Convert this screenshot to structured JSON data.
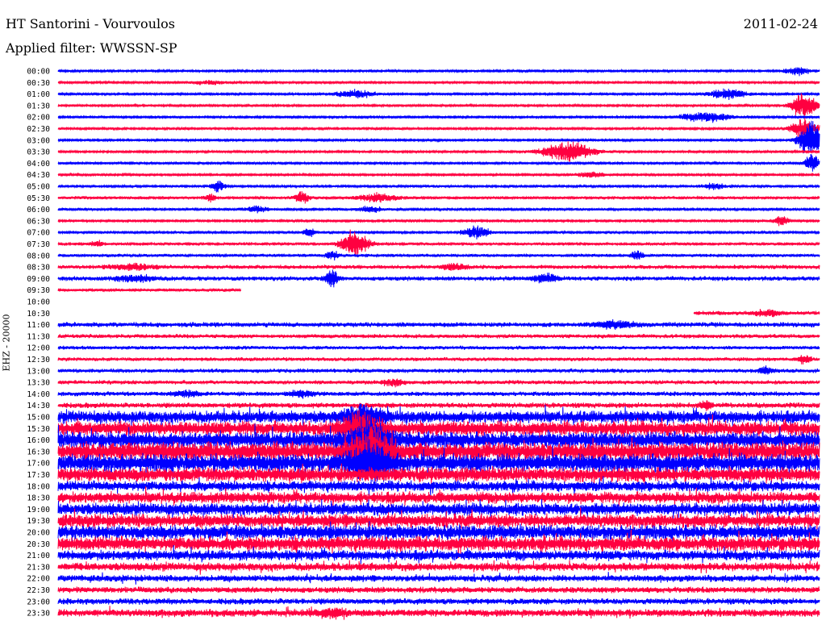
{
  "header": {
    "station": "HT Santorini - Vourvoulos",
    "date": "2011-02-24",
    "filter": "Applied filter: WWSSN-SP"
  },
  "channel_label": "EHZ - 20000",
  "colors": {
    "odd_trace": "#0000ff",
    "even_trace": "#ff0040"
  },
  "chart_data": {
    "type": "line",
    "description_type": "helicorder",
    "row_labels": [
      "00:00",
      "00:30",
      "01:00",
      "01:30",
      "02:00",
      "02:30",
      "03:00",
      "03:30",
      "04:00",
      "04:30",
      "05:00",
      "05:30",
      "06:00",
      "06:30",
      "07:00",
      "07:30",
      "08:00",
      "08:30",
      "09:00",
      "09:30",
      "10:00",
      "10:30",
      "11:00",
      "11:30",
      "12:00",
      "12:30",
      "13:00",
      "13:30",
      "14:00",
      "14:30",
      "15:00",
      "15:30",
      "16:00",
      "16:30",
      "17:00",
      "17:30",
      "18:00",
      "18:30",
      "19:00",
      "19:30",
      "20:00",
      "20:30",
      "21:00",
      "21:30",
      "22:00",
      "22:30",
      "23:00",
      "23:30"
    ],
    "row_minutes": 30,
    "rows": [
      {
        "amp": 1.0,
        "start": 0,
        "end": 1,
        "events": [
          [
            0.97,
            4,
            0.02
          ]
        ]
      },
      {
        "amp": 1.0,
        "start": 0,
        "end": 1,
        "events": [
          [
            0.2,
            2,
            0.03
          ]
        ]
      },
      {
        "amp": 1.0,
        "start": 0,
        "end": 1,
        "events": [
          [
            0.39,
            4,
            0.03
          ],
          [
            0.88,
            5,
            0.03
          ]
        ]
      },
      {
        "amp": 1.0,
        "start": 0,
        "end": 1,
        "events": [
          [
            0.98,
            12,
            0.02
          ]
        ]
      },
      {
        "amp": 1.0,
        "start": 0,
        "end": 1,
        "events": [
          [
            0.85,
            5,
            0.04
          ]
        ]
      },
      {
        "amp": 1.2,
        "start": 0,
        "end": 1,
        "events": [
          [
            0.98,
            10,
            0.02
          ]
        ]
      },
      {
        "amp": 1.0,
        "start": 0,
        "end": 1,
        "events": [
          [
            0.99,
            18,
            0.02
          ]
        ]
      },
      {
        "amp": 1.0,
        "start": 0,
        "end": 1,
        "events": [
          [
            0.67,
            10,
            0.04
          ]
        ]
      },
      {
        "amp": 1.0,
        "start": 0,
        "end": 1,
        "events": [
          [
            0.99,
            10,
            0.01
          ]
        ]
      },
      {
        "amp": 1.0,
        "start": 0,
        "end": 1,
        "events": [
          [
            0.7,
            3,
            0.02
          ]
        ]
      },
      {
        "amp": 1.2,
        "start": 0,
        "end": 1,
        "events": [
          [
            0.21,
            6,
            0.01
          ],
          [
            0.86,
            3,
            0.02
          ]
        ]
      },
      {
        "amp": 1.5,
        "start": 0,
        "end": 1,
        "events": [
          [
            0.32,
            6,
            0.01
          ],
          [
            0.42,
            4,
            0.03
          ],
          [
            0.2,
            3,
            0.01
          ]
        ]
      },
      {
        "amp": 1.2,
        "start": 0,
        "end": 1,
        "events": [
          [
            0.41,
            3,
            0.02
          ],
          [
            0.26,
            3,
            0.02
          ]
        ]
      },
      {
        "amp": 1.2,
        "start": 0,
        "end": 1,
        "events": [
          [
            0.95,
            5,
            0.01
          ]
        ]
      },
      {
        "amp": 1.2,
        "start": 0,
        "end": 1,
        "events": [
          [
            0.33,
            4,
            0.01
          ],
          [
            0.55,
            6,
            0.02
          ]
        ]
      },
      {
        "amp": 1.4,
        "start": 0,
        "end": 1,
        "events": [
          [
            0.39,
            14,
            0.02
          ],
          [
            0.05,
            3,
            0.01
          ]
        ]
      },
      {
        "amp": 1.5,
        "start": 0,
        "end": 1,
        "events": [
          [
            0.36,
            4,
            0.01
          ],
          [
            0.76,
            4,
            0.01
          ]
        ]
      },
      {
        "amp": 2.0,
        "start": 0,
        "end": 1,
        "events": [
          [
            0.1,
            3,
            0.03
          ],
          [
            0.52,
            3,
            0.02
          ]
        ]
      },
      {
        "amp": 2.2,
        "start": 0,
        "end": 1,
        "events": [
          [
            0.36,
            8,
            0.01
          ],
          [
            0.64,
            4,
            0.02
          ],
          [
            0.1,
            3,
            0.03
          ]
        ]
      },
      {
        "amp": 1.5,
        "start": 0,
        "end": 0.24,
        "events": []
      },
      {
        "amp": 0,
        "start": 0,
        "end": 0,
        "events": []
      },
      {
        "amp": 2.0,
        "start": 0.835,
        "end": 1,
        "events": [
          [
            0.93,
            3,
            0.02
          ]
        ]
      },
      {
        "amp": 2.4,
        "start": 0.0,
        "end": 1,
        "events": [
          [
            0.73,
            3,
            0.03
          ]
        ]
      },
      {
        "amp": 2.0,
        "start": 0,
        "end": 1,
        "events": []
      },
      {
        "amp": 1.8,
        "start": 0,
        "end": 1,
        "events": []
      },
      {
        "amp": 1.8,
        "start": 0,
        "end": 1,
        "events": [
          [
            0.98,
            4,
            0.01
          ]
        ]
      },
      {
        "amp": 2.0,
        "start": 0,
        "end": 1,
        "events": [
          [
            0.93,
            4,
            0.01
          ]
        ]
      },
      {
        "amp": 2.0,
        "start": 0,
        "end": 1,
        "events": [
          [
            0.44,
            3,
            0.02
          ]
        ]
      },
      {
        "amp": 2.2,
        "start": 0,
        "end": 1,
        "events": [
          [
            0.17,
            3,
            0.02
          ],
          [
            0.32,
            3,
            0.02
          ]
        ]
      },
      {
        "amp": 2.6,
        "start": 0,
        "end": 1,
        "events": [
          [
            0.85,
            4,
            0.01
          ]
        ]
      },
      {
        "amp": 6.0,
        "start": 0,
        "end": 1,
        "events": [
          [
            0.4,
            10,
            0.03
          ]
        ]
      },
      {
        "amp": 7.0,
        "start": 0,
        "end": 1,
        "events": [
          [
            0.4,
            14,
            0.03
          ]
        ]
      },
      {
        "amp": 8.0,
        "start": 0,
        "end": 1,
        "events": [
          [
            0.41,
            16,
            0.03
          ]
        ]
      },
      {
        "amp": 9.0,
        "start": 0,
        "end": 1,
        "events": [
          [
            0.41,
            20,
            0.03
          ]
        ]
      },
      {
        "amp": 9.0,
        "start": 0,
        "end": 1,
        "events": [
          [
            0.41,
            18,
            0.03
          ]
        ]
      },
      {
        "amp": 7.0,
        "start": 0,
        "end": 1,
        "events": []
      },
      {
        "amp": 5.0,
        "start": 0,
        "end": 1,
        "events": []
      },
      {
        "amp": 5.5,
        "start": 0,
        "end": 1,
        "events": []
      },
      {
        "amp": 6.0,
        "start": 0,
        "end": 1,
        "events": []
      },
      {
        "amp": 6.5,
        "start": 0,
        "end": 1,
        "events": []
      },
      {
        "amp": 7.0,
        "start": 0,
        "end": 1,
        "events": []
      },
      {
        "amp": 7.0,
        "start": 0,
        "end": 1,
        "events": []
      },
      {
        "amp": 5.0,
        "start": 0,
        "end": 1,
        "events": []
      },
      {
        "amp": 4.0,
        "start": 0,
        "end": 1,
        "events": []
      },
      {
        "amp": 3.2,
        "start": 0,
        "end": 1,
        "events": []
      },
      {
        "amp": 3.0,
        "start": 0,
        "end": 1,
        "events": []
      },
      {
        "amp": 3.0,
        "start": 0,
        "end": 1,
        "events": []
      },
      {
        "amp": 3.6,
        "start": 0,
        "end": 1,
        "events": [
          [
            0.36,
            4,
            0.02
          ]
        ]
      }
    ]
  }
}
